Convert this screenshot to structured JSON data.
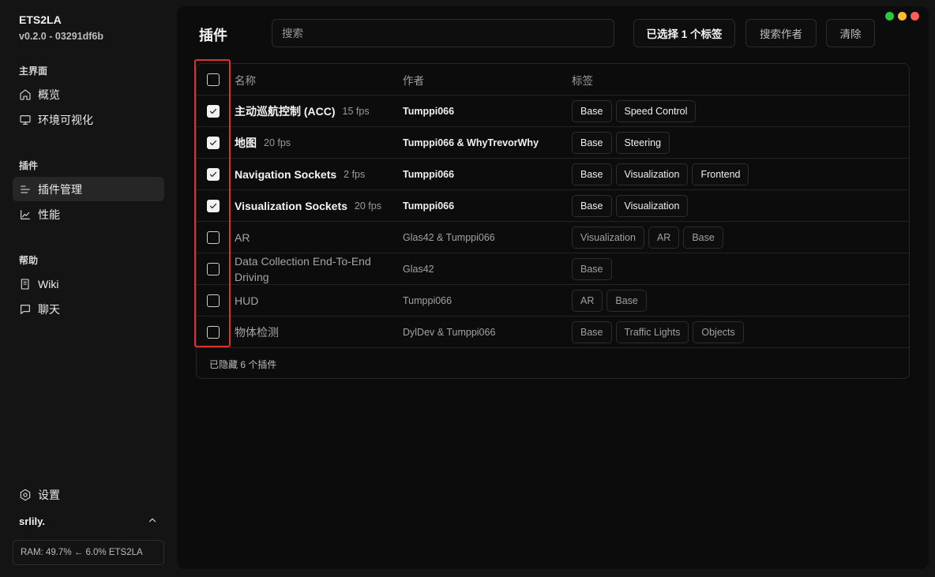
{
  "app": {
    "name": "ETS2LA",
    "version": "v0.2.0 - 03291df6b"
  },
  "sidebar": {
    "sections": [
      {
        "label": "主界面",
        "items": [
          {
            "label": "概览",
            "icon": "home-icon"
          },
          {
            "label": "环境可视化",
            "icon": "monitor-icon"
          }
        ]
      },
      {
        "label": "插件",
        "items": [
          {
            "label": "插件管理",
            "icon": "list-icon",
            "active": true
          },
          {
            "label": "性能",
            "icon": "chart-icon"
          }
        ]
      },
      {
        "label": "帮助",
        "items": [
          {
            "label": "Wiki",
            "icon": "book-icon"
          },
          {
            "label": "聊天",
            "icon": "chat-icon"
          }
        ]
      }
    ],
    "settings_label": "设置",
    "user": "srlily.",
    "status": "RAM: 49.7% ← 6.0% ETS2LA"
  },
  "main": {
    "title": "插件",
    "search_placeholder": "搜索",
    "selected_tags_label": "已选择 1 个标签",
    "search_author_label": "搜索作者",
    "clear_label": "清除",
    "columns": {
      "name": "名称",
      "author": "作者",
      "tags": "标签"
    },
    "plugins": [
      {
        "name": "主动巡航控制 (ACC)",
        "fps": "15 fps",
        "author": "Tumppi066",
        "tags": [
          "Base",
          "Speed Control"
        ],
        "enabled": true
      },
      {
        "name": "地图",
        "fps": "20 fps",
        "author": "Tumppi066 & WhyTrevorWhy",
        "tags": [
          "Base",
          "Steering"
        ],
        "enabled": true
      },
      {
        "name": "Navigation Sockets",
        "fps": "2 fps",
        "author": "Tumppi066",
        "tags": [
          "Base",
          "Visualization",
          "Frontend"
        ],
        "enabled": true
      },
      {
        "name": "Visualization Sockets",
        "fps": "20 fps",
        "author": "Tumppi066",
        "tags": [
          "Base",
          "Visualization"
        ],
        "enabled": true
      },
      {
        "name": "AR",
        "fps": "",
        "author": "Glas42 & Tumppi066",
        "tags": [
          "Visualization",
          "AR",
          "Base"
        ],
        "enabled": false
      },
      {
        "name": "Data Collection End-To-End Driving",
        "fps": "",
        "author": "Glas42",
        "tags": [
          "Base"
        ],
        "enabled": false
      },
      {
        "name": "HUD",
        "fps": "",
        "author": "Tumppi066",
        "tags": [
          "AR",
          "Base"
        ],
        "enabled": false
      },
      {
        "name": "物体检测",
        "fps": "",
        "author": "DylDev & Tumppi066",
        "tags": [
          "Base",
          "Traffic Lights",
          "Objects"
        ],
        "enabled": false
      }
    ],
    "hidden_count_text": "已隐藏 6 个插件"
  },
  "window_controls": {
    "colors": [
      "#27c93f",
      "#ffbd2e",
      "#ff5f56"
    ]
  }
}
